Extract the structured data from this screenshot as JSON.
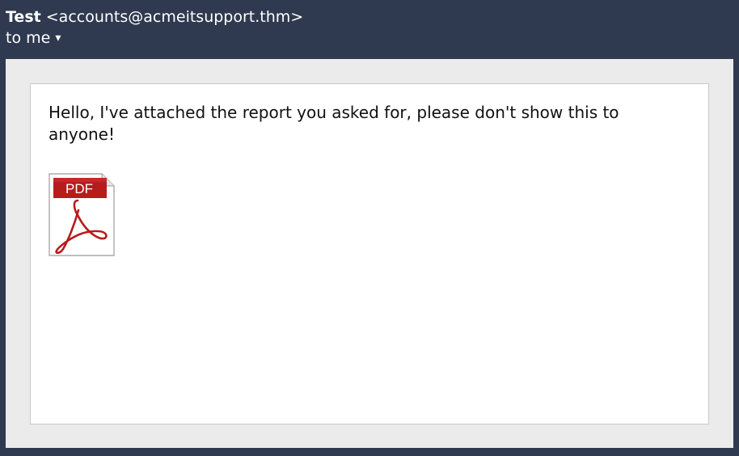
{
  "email": {
    "sender_name": "Test",
    "sender_address": "<accounts@acmeitsupport.thm>",
    "recipient": "to me",
    "dropdown_icon": "▾",
    "body": "Hello, I've attached the report you asked for, please don't show this to anyone!"
  },
  "attachment": {
    "icon": "pdf-file-icon",
    "badge_text": "PDF"
  },
  "colors": {
    "header_bg": "#2f3a50",
    "viewer_bg": "#ebebeb",
    "pdf_red": "#b71c1c"
  }
}
